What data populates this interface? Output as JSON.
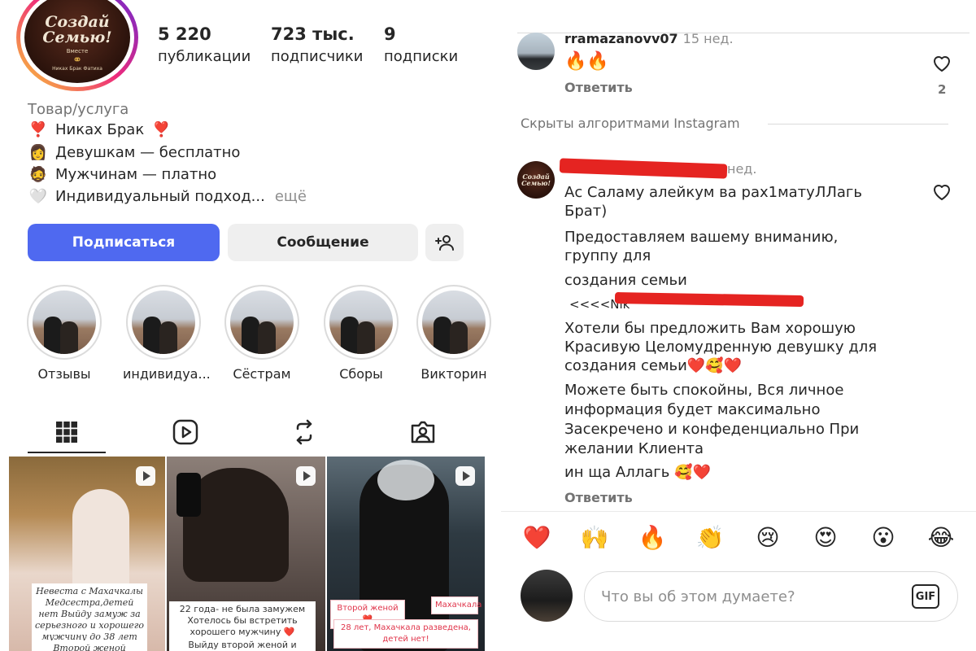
{
  "profile": {
    "logo": {
      "title": "Создай Семью!",
      "sub": "Вместе",
      "foot": "Никах Брак Фатиха"
    },
    "stats": [
      {
        "value": "5 220",
        "label": "публикации"
      },
      {
        "value": "723 тыс.",
        "label": "подписчики"
      },
      {
        "value": "9",
        "label": "подписки"
      }
    ],
    "category": "Товар/услуга",
    "bio": [
      {
        "emoji": "❣️",
        "text": "Никах Брак",
        "emoji_after": "❣️"
      },
      {
        "emoji": "👩",
        "text": "Девушкам — бесплатно"
      },
      {
        "emoji": "🧔",
        "text": "Мужчинам — платно"
      },
      {
        "emoji": "🤍",
        "text": "Индивидуальный подход...",
        "more": "ещё"
      }
    ],
    "buttons": {
      "follow": "Подписаться",
      "message": "Сообщение"
    },
    "highlights": [
      "Отзывы",
      "индивидуа...",
      "Сёстрам",
      "Сборы",
      "Викторин"
    ],
    "tabs": [
      "grid-icon",
      "reels-icon",
      "reposts-icon",
      "tagged-icon"
    ],
    "posts": [
      {
        "caption": "Невеста с Махачкалы Медсестра,детей нет Выйду замуж за серьезного и хорошего мужчину до 38 лет",
        "caption2": "Второй женой согласна"
      },
      {
        "caption": "22 года- не была замужем Хотелось бы встретить хорошего мужчину ❤️",
        "caption2": "Выйду второй женой и только!"
      },
      {
        "tag1": "Второй женой ❤️",
        "tag2": "Махачкала",
        "caption": "28 лет, Махачкала разведена, детей нет!"
      }
    ]
  },
  "comments": {
    "first": {
      "username": "rramazanovv07",
      "time": "15 нед.",
      "text": "🔥🔥",
      "reply": "Ответить",
      "likes": "2"
    },
    "hidden_label": "Скрыты алгоритмами Instagram",
    "second": {
      "time": "нед.",
      "lines": [
        "Ас Саламу алейкум ва рах1матуЛЛагь",
        "Брат)",
        "Предоставляем вашему вниманию,",
        "группу для",
        "создания семьи",
        "<<<<Nik",
        "Хотели бы предложить  Вам хорошую",
        "Красивую Целомудренную девушку  для",
        "создания семьи❤️🥰❤️",
        "Можете быть спокойны, Вся личное",
        "информация будет максимально",
        "Засекречено и конфеденциально  При",
        "желании Клиента",
        "ин ща Аллагь 🥰❤️"
      ],
      "reply": "Ответить"
    },
    "reactions": [
      "❤️",
      "🙌",
      "🔥",
      "👏",
      "😢",
      "😍",
      "😮",
      "😂"
    ],
    "input_placeholder": "Что вы об этом думаете?",
    "gif_label": "GIF"
  }
}
